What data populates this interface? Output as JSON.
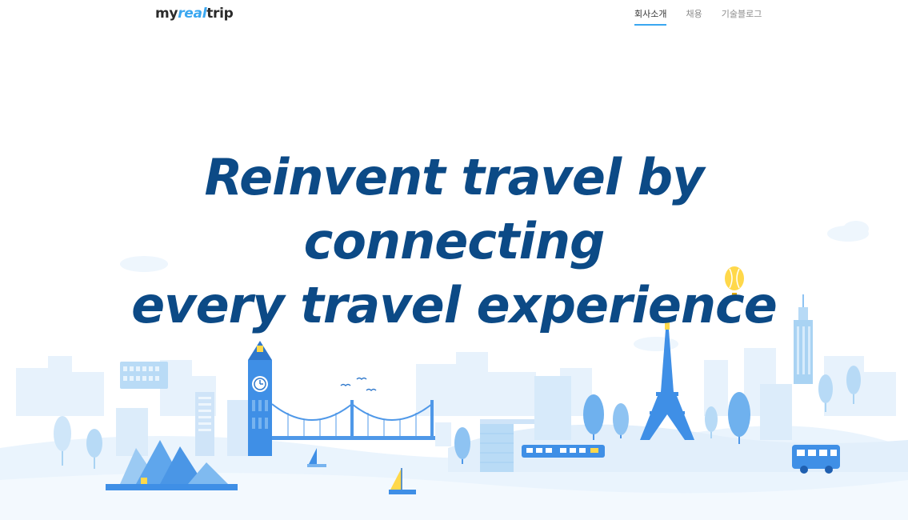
{
  "header": {
    "logo_prefix": "my",
    "logo_accent": "real",
    "logo_suffix": "trip",
    "nav": [
      {
        "label": "회사소개",
        "active": true
      },
      {
        "label": "채용",
        "active": false
      },
      {
        "label": "기술블로그",
        "active": false
      }
    ]
  },
  "hero": {
    "line1": "Reinvent travel by",
    "line2": "connecting",
    "line3": "every travel experience"
  },
  "colors": {
    "accent": "#3aa7f0",
    "headline": "#0c4a86",
    "illustration_primary": "#3f8fe6",
    "illustration_light": "#d6ecfb",
    "highlight_yellow": "#ffd84a"
  },
  "icons": [
    "hot-air-balloon-icon",
    "sydney-opera-house-icon",
    "big-ben-icon",
    "bridge-icon",
    "eiffel-tower-icon",
    "empire-state-building-icon",
    "bus-icon",
    "train-icon",
    "sailboat-icon",
    "colosseum-icon",
    "bird-icon"
  ]
}
